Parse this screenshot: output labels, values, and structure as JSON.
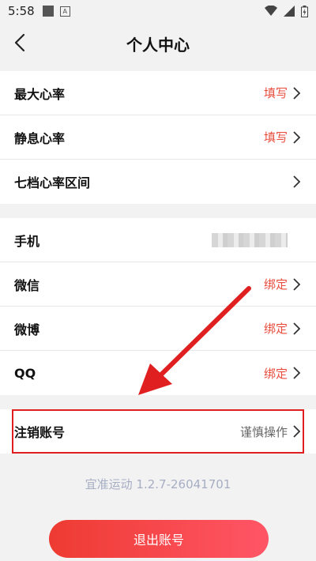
{
  "status_bar": {
    "time": "5:58"
  },
  "header": {
    "title": "个人中心"
  },
  "group1": [
    {
      "label": "最大心率",
      "value": "填写"
    },
    {
      "label": "静息心率",
      "value": "填写"
    },
    {
      "label": "七档心率区间",
      "value": ""
    }
  ],
  "group2": [
    {
      "label": "手机",
      "value": ""
    },
    {
      "label": "微信",
      "value": "绑定"
    },
    {
      "label": "微博",
      "value": "绑定"
    },
    {
      "label": "QQ",
      "value": "绑定"
    }
  ],
  "cancel_account": {
    "label": "注销账号",
    "value": "谨慎操作"
  },
  "version": "宜准运动  1.2.7-26041701",
  "logout_label": "退出账号",
  "colors": {
    "accent": "#e74c3c",
    "annotation": "#e02020",
    "background": "#f2f2f2"
  }
}
